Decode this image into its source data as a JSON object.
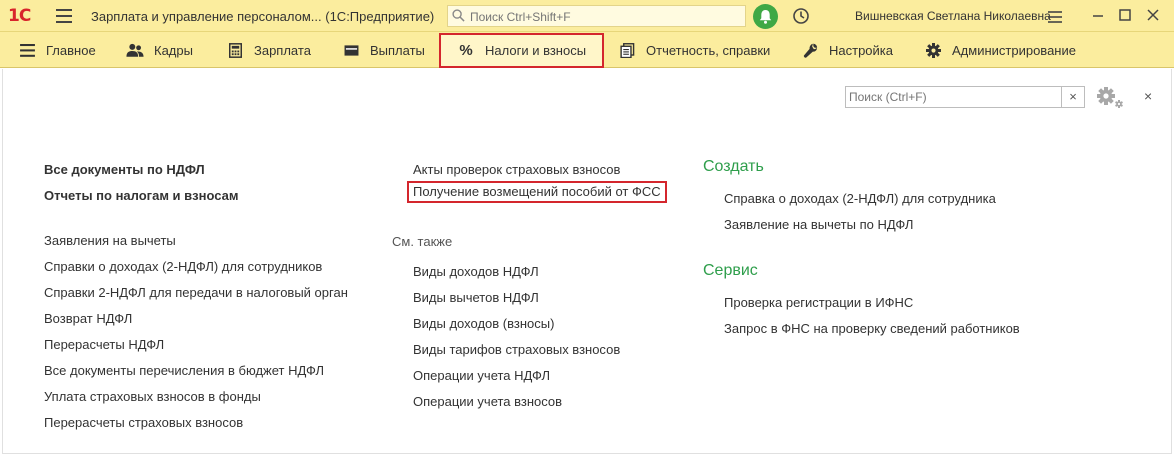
{
  "titlebar": {
    "logo": "1С",
    "app_title": "Зарплата и управление персоналом... (1С:Предприятие)",
    "search_placeholder": "Поиск Ctrl+Shift+F",
    "username": "Вишневская Светлана Николаевна"
  },
  "sections": [
    {
      "label": "Главное",
      "icon": "hamburger-icon"
    },
    {
      "label": "Кадры",
      "icon": "people-icon"
    },
    {
      "label": "Зарплата",
      "icon": "calculator-icon"
    },
    {
      "label": "Выплаты",
      "icon": "wallet-icon"
    },
    {
      "label": "Налоги и взносы",
      "icon": "percent-icon",
      "active": true
    },
    {
      "label": "Отчетность, справки",
      "icon": "documents-icon"
    },
    {
      "label": "Настройка",
      "icon": "wrench-icon"
    },
    {
      "label": "Администрирование",
      "icon": "gear-icon"
    }
  ],
  "panel": {
    "search_placeholder": "Поиск (Ctrl+F)",
    "clear_label": "×",
    "close_label": "×"
  },
  "col1": {
    "bold_items": [
      "Все документы по НДФЛ",
      "Отчеты по налогам и взносам"
    ],
    "items": [
      "Заявления на вычеты",
      "Справки о доходах (2-НДФЛ) для сотрудников",
      "Справки 2-НДФЛ для передачи в налоговый орган",
      "Возврат НДФЛ",
      "Перерасчеты НДФЛ",
      "Все документы перечисления в бюджет НДФЛ",
      "Уплата страховых взносов в фонды",
      "Перерасчеты страховых взносов"
    ]
  },
  "col2": {
    "items": [
      "Акты проверок страховых взносов",
      "Получение возмещений пособий от ФСС"
    ],
    "see_also_label": "См. также",
    "see_also": [
      "Виды доходов НДФЛ",
      "Виды вычетов НДФЛ",
      "Виды доходов (взносы)",
      "Виды тарифов страховых взносов",
      "Операции учета НДФЛ",
      "Операции учета взносов"
    ]
  },
  "col3": {
    "create_label": "Создать",
    "create_items": [
      "Справка о доходах (2-НДФЛ) для сотрудника",
      "Заявление на вычеты по НДФЛ"
    ],
    "service_label": "Сервис",
    "service_items": [
      "Проверка регистрации в ИФНС",
      "Запрос в ФНС на проверку сведений работников"
    ]
  },
  "colors": {
    "accent_green": "#2e9e4b",
    "highlight_red": "#d4262d",
    "toolbar_bg": "#fbed9e"
  }
}
